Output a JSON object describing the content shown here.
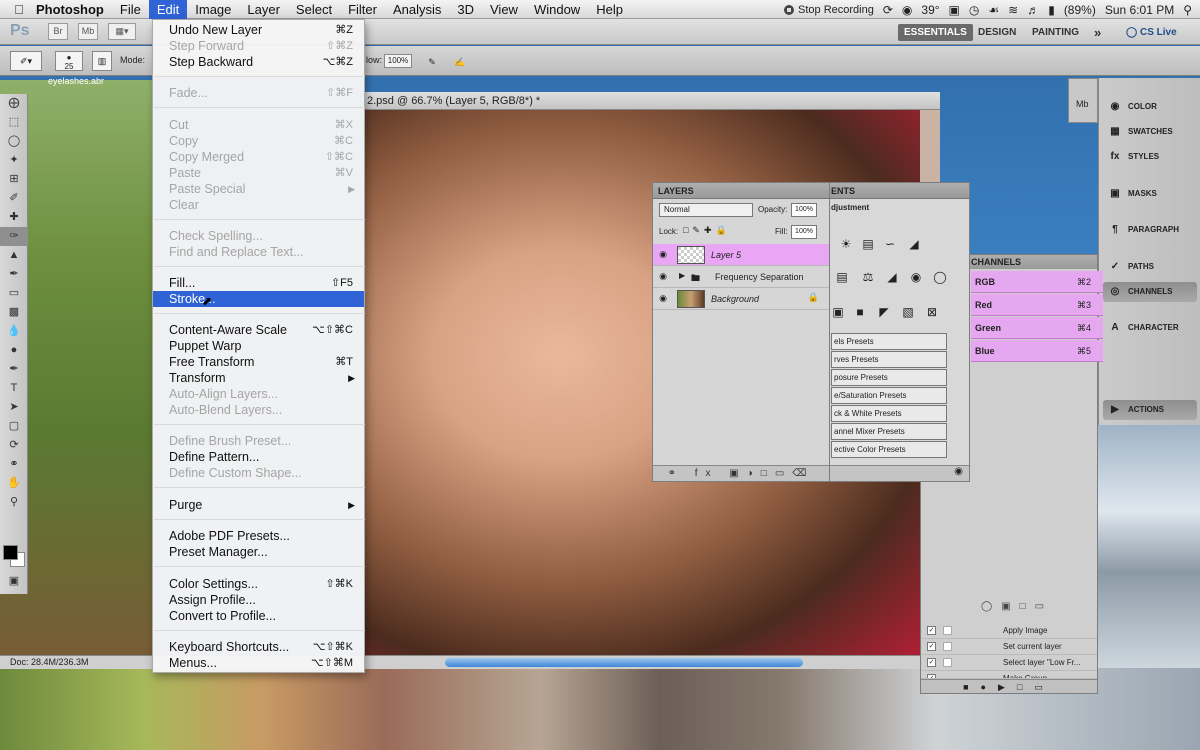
{
  "menubar": {
    "apple": "",
    "app": "Photoshop",
    "items": [
      "File",
      "Edit",
      "Image",
      "Layer",
      "Select",
      "Filter",
      "Analysis",
      "3D",
      "View",
      "Window",
      "Help"
    ],
    "stop_recording": "Stop Recording",
    "temp": "39°",
    "battery": "(89%)",
    "clock": "Sun 6:01 PM"
  },
  "appbar": {
    "logo": "Ps",
    "btn_br": "Br",
    "btn_mb": "Mb",
    "workspaces": [
      "ESSENTIALS",
      "DESIGN",
      "PAINTING"
    ],
    "more": "»",
    "cs_live": "CS Live"
  },
  "options": {
    "brush_size": "25",
    "mode_label": "Mode:",
    "flow_label": "low:",
    "flow_value": "100%"
  },
  "canvas": {
    "small_label": "eyelashes.abr",
    "small_label_top": "SS",
    "doc_title": "2.psd @ 66.7% (Layer 5, RGB/8*) *",
    "doc_size": "Doc: 28.4M/236.3M"
  },
  "edit_menu": [
    {
      "label": "Undo New Layer",
      "shortcut": "⌘Z",
      "disabled": false
    },
    {
      "label": "Step Forward",
      "shortcut": "⇧⌘Z",
      "disabled": true
    },
    {
      "label": "Step Backward",
      "shortcut": "⌥⌘Z",
      "disabled": false
    },
    {
      "label": "Fade...",
      "shortcut": "⇧⌘F",
      "disabled": true
    },
    {
      "label": "Cut",
      "shortcut": "⌘X",
      "disabled": true
    },
    {
      "label": "Copy",
      "shortcut": "⌘C",
      "disabled": true
    },
    {
      "label": "Copy Merged",
      "shortcut": "⇧⌘C",
      "disabled": true
    },
    {
      "label": "Paste",
      "shortcut": "⌘V",
      "disabled": true
    },
    {
      "label": "Paste Special",
      "shortcut": "",
      "disabled": true
    },
    {
      "label": "Clear",
      "shortcut": "",
      "disabled": true
    },
    {
      "label": "Check Spelling...",
      "shortcut": "",
      "disabled": true
    },
    {
      "label": "Find and Replace Text...",
      "shortcut": "",
      "disabled": true
    },
    {
      "label": "Fill...",
      "shortcut": "⇧F5",
      "disabled": false
    },
    {
      "label": "Stroke...",
      "shortcut": "",
      "disabled": false
    },
    {
      "label": "Content-Aware Scale",
      "shortcut": "⌥⇧⌘C",
      "disabled": false
    },
    {
      "label": "Puppet Warp",
      "shortcut": "",
      "disabled": false
    },
    {
      "label": "Free Transform",
      "shortcut": "⌘T",
      "disabled": false
    },
    {
      "label": "Transform",
      "shortcut": "",
      "disabled": false
    },
    {
      "label": "Auto-Align Layers...",
      "shortcut": "",
      "disabled": true
    },
    {
      "label": "Auto-Blend Layers...",
      "shortcut": "",
      "disabled": true
    },
    {
      "label": "Define Brush Preset...",
      "shortcut": "",
      "disabled": true
    },
    {
      "label": "Define Pattern...",
      "shortcut": "",
      "disabled": false
    },
    {
      "label": "Define Custom Shape...",
      "shortcut": "",
      "disabled": true
    },
    {
      "label": "Purge",
      "shortcut": "",
      "disabled": false
    },
    {
      "label": "Adobe PDF Presets...",
      "shortcut": "",
      "disabled": false
    },
    {
      "label": "Preset Manager...",
      "shortcut": "",
      "disabled": false
    },
    {
      "label": "Color Settings...",
      "shortcut": "⇧⌘K",
      "disabled": false
    },
    {
      "label": "Assign Profile...",
      "shortcut": "",
      "disabled": false
    },
    {
      "label": "Convert to Profile...",
      "shortcut": "",
      "disabled": false
    },
    {
      "label": "Keyboard Shortcuts...",
      "shortcut": "⌥⇧⌘K",
      "disabled": false
    },
    {
      "label": "Menus...",
      "shortcut": "⌥⇧⌘M",
      "disabled": false
    }
  ],
  "layers_panel": {
    "title": "LAYERS",
    "blend": "Normal",
    "opacity_label": "Opacity:",
    "opacity": "100%",
    "lock_label": "Lock:",
    "fill_label": "Fill:",
    "fill": "100%",
    "layers": [
      {
        "name": "Layer 5",
        "selected": true
      },
      {
        "name": "Frequency Separation",
        "selected": false
      },
      {
        "name": "Background",
        "selected": false
      }
    ]
  },
  "adjustments_panel": {
    "title": "ENTS",
    "subtitle": "djustment",
    "presets": [
      "els Presets",
      "rves Presets",
      "posure Presets",
      "e/Saturation Presets",
      "ck & White Presets",
      "annel Mixer Presets",
      "ective Color Presets"
    ]
  },
  "channels_panel": {
    "title": "CHANNELS",
    "channels": [
      {
        "name": "RGB",
        "shortcut": "⌘2"
      },
      {
        "name": "Red",
        "shortcut": "⌘3"
      },
      {
        "name": "Green",
        "shortcut": "⌘4"
      },
      {
        "name": "Blue",
        "shortcut": "⌘5"
      }
    ]
  },
  "actions_list": [
    "Apply Image",
    "Set current layer",
    "Select layer \"Low Fr...",
    "Make Group"
  ],
  "dock": [
    "COLOR",
    "SWATCHES",
    "STYLES",
    "MASKS",
    "PARAGRAPH",
    "PATHS",
    "CHANNELS",
    "CHARACTER",
    "ACTIONS"
  ],
  "colors": {
    "menu_highlight": "#2f63d6",
    "channel_highlight": "#e5a8f0",
    "layer_selected": "#e8a6f4"
  }
}
